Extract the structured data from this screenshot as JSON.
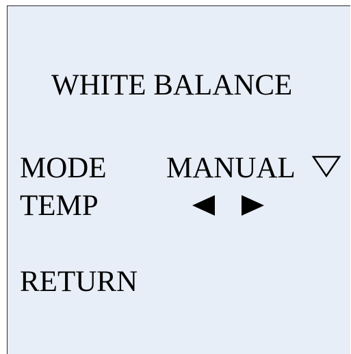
{
  "menu": {
    "title": "WHITE BALANCE",
    "mode": {
      "label": "MODE",
      "value": "MANUAL",
      "dropdown_icon": "down-triangle-outline-icon"
    },
    "temp": {
      "label": "TEMP",
      "decrease_icon": "left-triangle-icon",
      "increase_icon": "right-triangle-icon"
    },
    "return_label": "RETURN"
  },
  "colors": {
    "background": "#e8eef7",
    "text": "#000000",
    "border": "#2a2a2a"
  }
}
